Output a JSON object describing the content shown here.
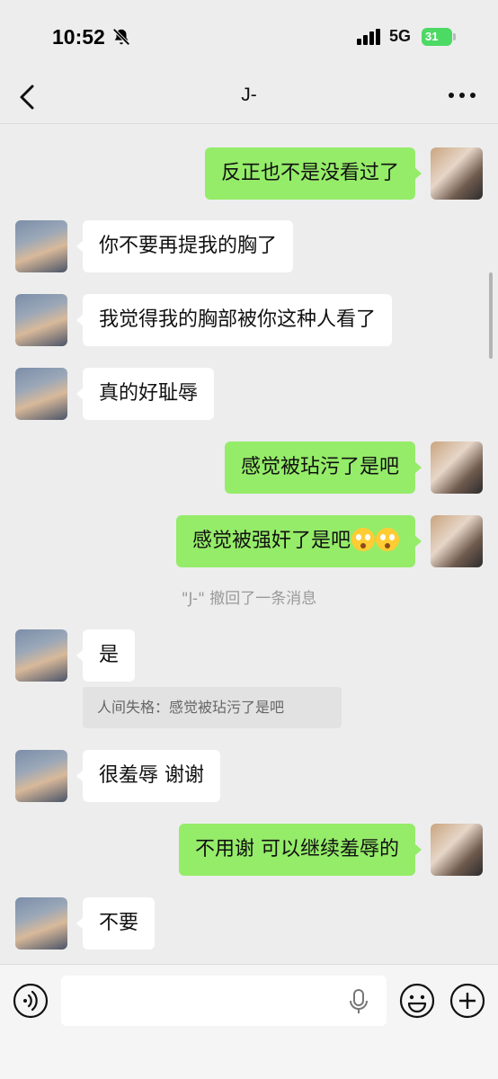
{
  "status_bar": {
    "time": "10:52",
    "network": "5G",
    "battery": "31"
  },
  "header": {
    "title": "J-"
  },
  "messages": [
    {
      "side": "self",
      "text": "反正也不是没看过了"
    },
    {
      "side": "other",
      "text": "你不要再提我的胸了"
    },
    {
      "side": "other",
      "text": "我觉得我的胸部被你这种人看了"
    },
    {
      "side": "other",
      "text": "真的好耻辱"
    },
    {
      "side": "self",
      "text": "感觉被玷污了是吧"
    },
    {
      "side": "self",
      "text": "感觉被强奸了是吧",
      "emojis": [
        "flushed-face-emoji",
        "flushed-face-emoji"
      ]
    },
    {
      "side": "other",
      "text": "是"
    },
    {
      "side": "other",
      "text": "很羞辱 谢谢"
    },
    {
      "side": "self",
      "text": "不用谢  可以继续羞辱的"
    },
    {
      "side": "other",
      "text": "不要"
    }
  ],
  "recall_notice": "\"J-\" 撤回了一条消息",
  "quote": "人间失格：感觉被玷污了是吧",
  "input": {
    "value": "",
    "placeholder": ""
  },
  "icons": [
    "bell-slash-icon",
    "signal-icon",
    "battery-icon",
    "back-icon",
    "more-icon",
    "voice-icon",
    "microphone-icon",
    "emoji-icon",
    "plus-icon"
  ],
  "colors": {
    "self_bubble": "#95ec69",
    "other_bubble": "#ffffff",
    "background": "#ededed"
  }
}
